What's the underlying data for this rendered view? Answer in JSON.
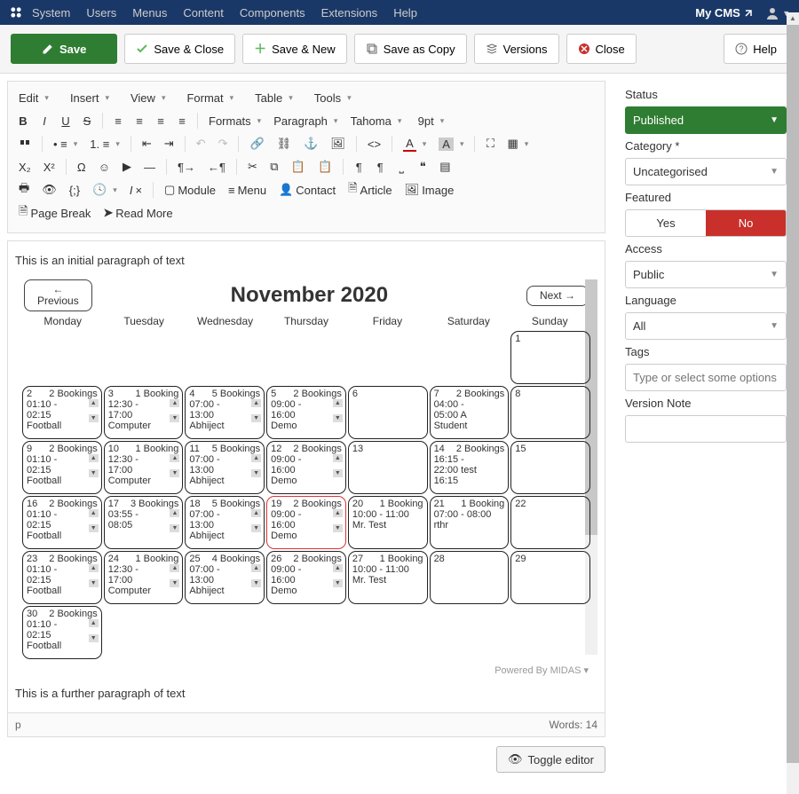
{
  "topbar": {
    "menu": [
      "System",
      "Users",
      "Menus",
      "Content",
      "Components",
      "Extensions",
      "Help"
    ],
    "site": "My CMS"
  },
  "actions": {
    "save": "Save",
    "save_close": "Save & Close",
    "save_new": "Save & New",
    "save_copy": "Save as Copy",
    "versions": "Versions",
    "close": "Close",
    "help": "Help"
  },
  "editor_menu": [
    "Edit",
    "Insert",
    "View",
    "Format",
    "Table",
    "Tools"
  ],
  "fmt": {
    "formats": "Formats",
    "block": "Paragraph",
    "font": "Tahoma",
    "size": "9pt"
  },
  "tb3": {
    "module": "Module",
    "menu": "Menu",
    "contact": "Contact",
    "article": "Article",
    "image": "Image",
    "pagebreak": "Page Break",
    "readmore": "Read More"
  },
  "content": {
    "para1": "This is an initial paragraph of text",
    "para2": "This is a further paragraph of text",
    "cal_title": "November 2020",
    "prev_s": "←",
    "prev": "Previous",
    "next": "Next →",
    "days": [
      "Monday",
      "Tuesday",
      "Wednesday",
      "Thursday",
      "Friday",
      "Saturday",
      "Sunday"
    ],
    "powered": "Powered By ",
    "powered_link": "MIDAS"
  },
  "cells": [
    {
      "empty": true
    },
    {
      "empty": true
    },
    {
      "empty": true
    },
    {
      "empty": true
    },
    {
      "empty": true
    },
    {
      "empty": true
    },
    {
      "d": "1"
    },
    {
      "d": "2",
      "b": "2 Bookings",
      "l1": "01:10 -",
      "l2": "02:15",
      "l3": "Football",
      "sp": true
    },
    {
      "d": "3",
      "b": "1 Booking",
      "l1": "12:30 -",
      "l2": "17:00",
      "l3": "Computer",
      "sp": true
    },
    {
      "d": "4",
      "b": "5 Bookings",
      "l1": "07:00 -",
      "l2": "13:00",
      "l3": "Abhiject",
      "sp": true
    },
    {
      "d": "5",
      "b": "2 Bookings",
      "l1": "09:00 -",
      "l2": "16:00",
      "l3": "Demo",
      "sp": true
    },
    {
      "d": "6"
    },
    {
      "d": "7",
      "b": "2 Bookings",
      "l1": "04:00 -",
      "l2": "05:00 A",
      "l3": "Student"
    },
    {
      "d": "8"
    },
    {
      "d": "9",
      "b": "2 Bookings",
      "l1": "01:10 -",
      "l2": "02:15",
      "l3": "Football",
      "sp": true
    },
    {
      "d": "10",
      "b": "1 Booking",
      "l1": "12:30 -",
      "l2": "17:00",
      "l3": "Computer",
      "sp": true
    },
    {
      "d": "11",
      "b": "5 Bookings",
      "l1": "07:00 -",
      "l2": "13:00",
      "l3": "Abhiject",
      "sp": true
    },
    {
      "d": "12",
      "b": "2 Bookings",
      "l1": "09:00 -",
      "l2": "16:00",
      "l3": "Demo",
      "sp": true
    },
    {
      "d": "13"
    },
    {
      "d": "14",
      "b": "2 Bookings",
      "l1": "16:15 -",
      "l2": "22:00 test",
      "l3": "16:15"
    },
    {
      "d": "15"
    },
    {
      "d": "16",
      "b": "2 Bookings",
      "l1": "01:10 -",
      "l2": "02:15",
      "l3": "Football",
      "sp": true
    },
    {
      "d": "17",
      "b": "3 Bookings",
      "l1": "03:55 -",
      "l2": "08:05",
      "sp": true
    },
    {
      "d": "18",
      "b": "5 Bookings",
      "l1": "07:00 -",
      "l2": "13:00",
      "l3": "Abhiject",
      "sp": true
    },
    {
      "d": "19",
      "b": "2 Bookings",
      "l1": "09:00 -",
      "l2": "16:00",
      "l3": "Demo",
      "sp": true,
      "today": true
    },
    {
      "d": "20",
      "b": "1 Booking",
      "l1": "10:00 - 11:00",
      "l2": "Mr. Test"
    },
    {
      "d": "21",
      "b": "1 Booking",
      "l1": "07:00 - 08:00",
      "l2": "rthr"
    },
    {
      "d": "22"
    },
    {
      "d": "23",
      "b": "2 Bookings",
      "l1": "01:10 -",
      "l2": "02:15",
      "l3": "Football",
      "sp": true
    },
    {
      "d": "24",
      "b": "1 Booking",
      "l1": "12:30 -",
      "l2": "17:00",
      "l3": "Computer",
      "sp": true
    },
    {
      "d": "25",
      "b": "4 Bookings",
      "l1": "07:00 -",
      "l2": "13:00",
      "l3": "Abhiject",
      "sp": true
    },
    {
      "d": "26",
      "b": "2 Bookings",
      "l1": "09:00 -",
      "l2": "16:00",
      "l3": "Demo",
      "sp": true
    },
    {
      "d": "27",
      "b": "1 Booking",
      "l1": "10:00 - 11:00",
      "l2": "Mr. Test"
    },
    {
      "d": "28"
    },
    {
      "d": "29"
    },
    {
      "d": "30",
      "b": "2 Bookings",
      "l1": "01:10 -",
      "l2": "02:15",
      "l3": "Football",
      "sp": true
    },
    {
      "empty": true
    },
    {
      "empty": true
    },
    {
      "empty": true
    },
    {
      "empty": true
    },
    {
      "empty": true
    },
    {
      "empty": true
    }
  ],
  "status": {
    "path": "p",
    "words": "Words: 14"
  },
  "toggle": "Toggle editor",
  "side": {
    "status_l": "Status",
    "status_v": "Published",
    "cat_l": "Category *",
    "cat_v": "Uncategorised",
    "feat_l": "Featured",
    "yes": "Yes",
    "no": "No",
    "access_l": "Access",
    "access_v": "Public",
    "lang_l": "Language",
    "lang_v": "All",
    "tags_l": "Tags",
    "tags_ph": "Type or select some options",
    "ver_l": "Version Note"
  }
}
